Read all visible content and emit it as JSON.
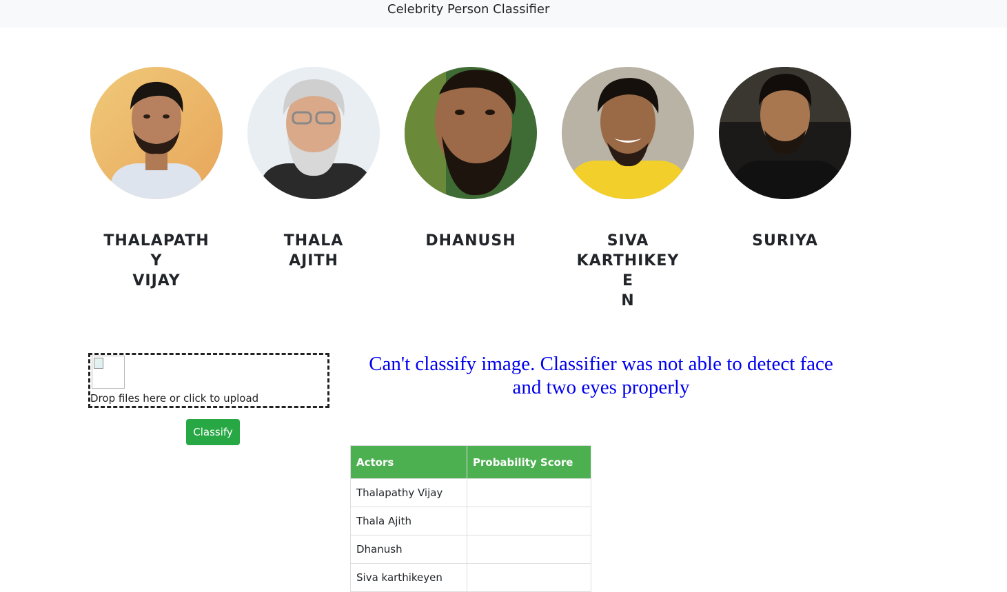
{
  "header": {
    "title": "Celebrity Person Classifier"
  },
  "celebrities": [
    {
      "name_lines": [
        "THALAPATHY",
        "VIJAY"
      ],
      "photo": "thalapathy-vijay-photo"
    },
    {
      "name_lines": [
        "THALA",
        "AJITH"
      ],
      "photo": "thala-ajith-photo"
    },
    {
      "name_lines": [
        "DHANUSH"
      ],
      "photo": "dhanush-photo"
    },
    {
      "name_lines": [
        "SIVA",
        "KARTHIKEYE",
        "N"
      ],
      "photo": "siva-karthikeyen-photo"
    },
    {
      "name_lines": [
        "SURIYA"
      ],
      "photo": "suriya-photo"
    }
  ],
  "upload": {
    "text": "Drop files here or click to upload"
  },
  "classify_button": {
    "label": "Classify"
  },
  "error": {
    "line1": "Can't classify image. Classifier was not able to detect face",
    "line2": "and two eyes properly"
  },
  "table": {
    "headers": [
      "Actors",
      "Probability Score"
    ],
    "rows": [
      [
        "Thalapathy Vijay",
        ""
      ],
      [
        "Thala Ajith",
        ""
      ],
      [
        "Dhanush",
        ""
      ],
      [
        "Siva karthikeyen",
        ""
      ]
    ]
  },
  "colors": {
    "button": "#28a745",
    "table_header": "#4caf50",
    "error_text": "#0000ee",
    "topbar": "#f8f9fa"
  }
}
